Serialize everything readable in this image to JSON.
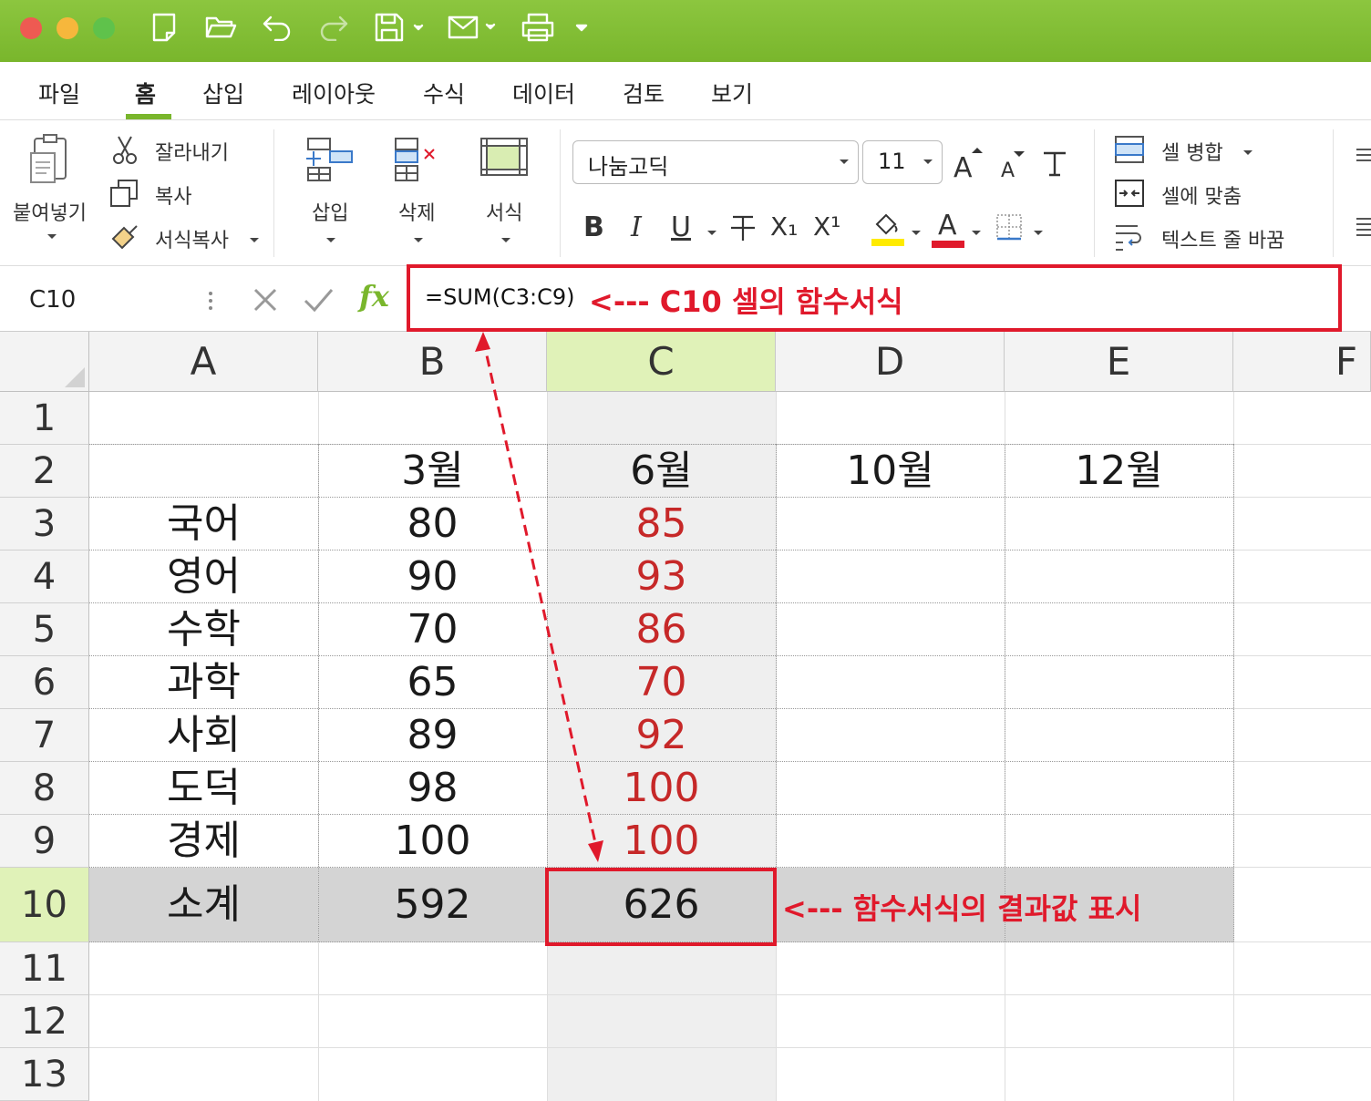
{
  "toolbar": {
    "colors": {
      "titlebar": "#7fbc33",
      "accent": "#79b62c",
      "annotation": "#e0192b",
      "value_red": "#c62828"
    },
    "quick_icons": [
      "new-file-icon",
      "open-folder-icon",
      "undo-icon",
      "redo-icon",
      "save-icon",
      "mail-icon",
      "print-icon",
      "customize-icon"
    ]
  },
  "menu": {
    "tabs": [
      "파일",
      "홈",
      "삽입",
      "레이아웃",
      "수식",
      "데이터",
      "검토",
      "보기"
    ],
    "active": "홈"
  },
  "ribbon": {
    "paste": "붙여넣기",
    "cut": "잘라내기",
    "copy": "복사",
    "format_painter": "서식복사",
    "insert": "삽입",
    "delete": "삭제",
    "format": "서식",
    "font_name": "나눔고딕",
    "font_size": "11",
    "bold": "B",
    "italic": "I",
    "underline": "U",
    "subscript": "X₁",
    "superscript": "X¹",
    "font_color": "A",
    "merge": "셀 병합",
    "fit": "셀에 맞춤",
    "wrap": "텍스트 줄 바꿈"
  },
  "formula": {
    "cell_ref": "C10",
    "fx": "fx",
    "content": "=SUM(C3:C9)",
    "annotation": "<--- C10 셀의 함수서식"
  },
  "sheet": {
    "columns": [
      "A",
      "B",
      "C",
      "D",
      "E",
      "F"
    ],
    "row_numbers": [
      "1",
      "2",
      "3",
      "4",
      "5",
      "6",
      "7",
      "8",
      "9",
      "10",
      "11",
      "12",
      "13"
    ],
    "header_row": {
      "B": "3월",
      "C": "6월",
      "D": "10월",
      "E": "12월"
    },
    "rows": [
      {
        "A": "국어",
        "B": "80",
        "C": "85"
      },
      {
        "A": "영어",
        "B": "90",
        "C": "93"
      },
      {
        "A": "수학",
        "B": "70",
        "C": "86"
      },
      {
        "A": "과학",
        "B": "65",
        "C": "70"
      },
      {
        "A": "사회",
        "B": "89",
        "C": "92"
      },
      {
        "A": "도덕",
        "B": "98",
        "C": "100"
      },
      {
        "A": "경제",
        "B": "100",
        "C": "100"
      }
    ],
    "total": {
      "A": "소계",
      "B": "592",
      "C": "626"
    },
    "result_annotation": "<--- 함수서식의 결과값 표시"
  }
}
